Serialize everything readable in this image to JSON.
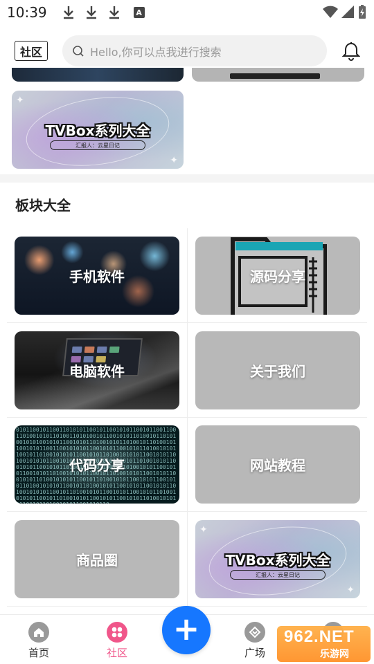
{
  "status_bar": {
    "time": "10:39",
    "badge": "A"
  },
  "header": {
    "community_label": "社区",
    "search_placeholder": "Hello,你可以点我进行搜索"
  },
  "top_banner": {
    "title": "TVBox系列大全",
    "subtitle": "汇报人：云星日记"
  },
  "section": {
    "title": "板块大全"
  },
  "boards": [
    {
      "label": "手机软件"
    },
    {
      "label": "源码分享"
    },
    {
      "label": "电脑软件"
    },
    {
      "label": "关于我们"
    },
    {
      "label": "代码分享"
    },
    {
      "label": "网站教程"
    },
    {
      "label": "商品圈"
    },
    {
      "label": "TVBox系列大全",
      "subtitle": "汇报人：云星日记"
    }
  ],
  "nav": {
    "home": "首页",
    "community": "社区",
    "square": "广场",
    "add_symbol": "+"
  },
  "watermark": {
    "top": "962.NET",
    "bottom": "乐游网"
  },
  "colors": {
    "accent_blue": "#1677ff",
    "community_pink": "#f0568a",
    "divider": "#f4f4f4",
    "placeholder_gray": "#b8b8b8"
  }
}
